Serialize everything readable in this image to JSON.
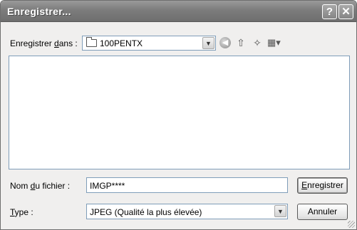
{
  "window": {
    "title": "Enregistrer..."
  },
  "titlebar": {
    "help_glyph": "?",
    "close_glyph": "✕"
  },
  "location": {
    "label_pre": "Enregistrer ",
    "label_u": "d",
    "label_post": "ans :",
    "folder": "100PENTX"
  },
  "toolbar": {
    "back_icon": "back-arrow-icon",
    "up_icon": "up-folder-icon",
    "new_folder_icon": "new-folder-icon",
    "views_icon": "views-menu-icon"
  },
  "filename": {
    "label_pre": "Nom ",
    "label_u": "d",
    "label_post": "u fichier :",
    "value": "IMGP****"
  },
  "filetype": {
    "label_u": "T",
    "label_post": "ype :",
    "value": "JPEG (Qualité la plus élevée)"
  },
  "buttons": {
    "save_u": "E",
    "save_rest": "nregistrer",
    "cancel": "Annuler"
  }
}
